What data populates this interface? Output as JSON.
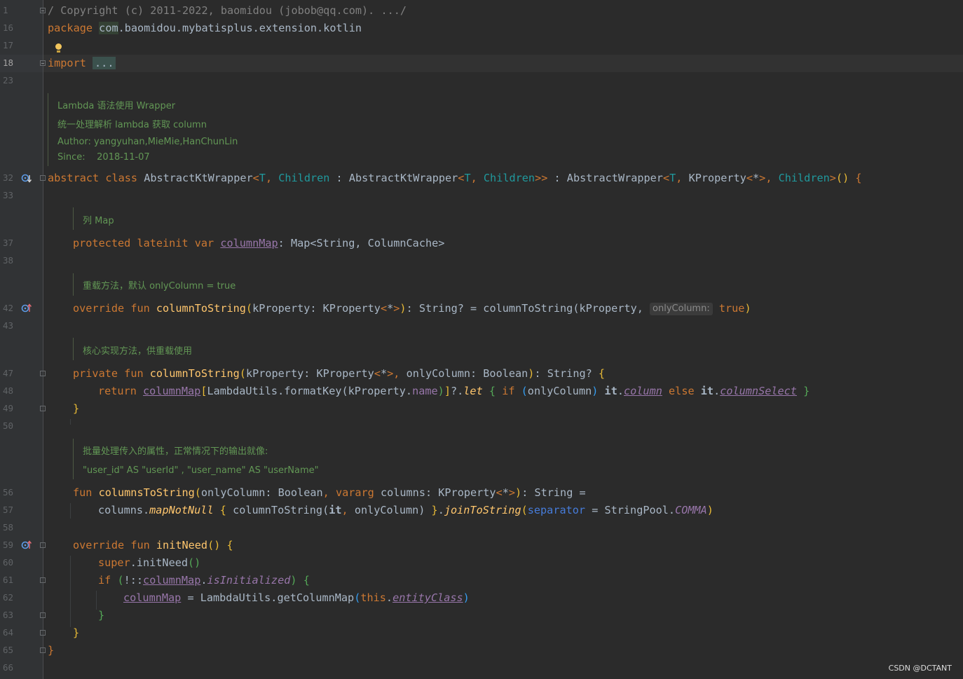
{
  "editor": {
    "current_line": "18",
    "line_numbers": [
      "1",
      "16",
      "17",
      "18",
      "23",
      "32",
      "33",
      "37",
      "38",
      "42",
      "43",
      "47",
      "48",
      "49",
      "50",
      "56",
      "57",
      "58",
      "59",
      "60",
      "61",
      "62",
      "63",
      "64",
      "65",
      "66"
    ],
    "line1_text": "/ Copyright (c) 2011-2022, baomidou (jobob@qq.com). .../",
    "package_keyword": "package",
    "package_first": "com",
    "package_rest": ".baomidou.mybatisplus.extension.kotlin",
    "import_keyword": "import",
    "import_folded": "...",
    "class_doc": [
      "Lambda 语法使用 Wrapper",
      "统一处理解析 lambda 获取 column",
      "Author: yangyuhan,MieMie,HanChunLin",
      "Since:    2018-11-07"
    ],
    "class_decl": {
      "kw_abstract": "abstract",
      "kw_class": "class",
      "name": "AbstractKtWrapper",
      "t": "T",
      "children": "Children",
      "ext1": "AbstractKtWrapper",
      "ext2": "AbstractWrapper",
      "kproperty": "KProperty",
      "star": "*"
    },
    "column_map_doc": "列 Map",
    "column_map_decl": {
      "kw1": "protected",
      "kw2": "lateinit",
      "kw3": "var",
      "name": "columnMap",
      "type": "Map<String, ColumnCache>"
    },
    "override_doc": "重载方法，默认 onlyColumn = true",
    "override_decl": {
      "kw1": "override",
      "kw2": "fun",
      "name": "columnToString",
      "params": "kProperty: KProperty",
      "ret": "String? = columnToString(kProperty, ",
      "hint": "onlyColumn:",
      "true_kw": "true"
    },
    "core_doc": "核心实现方法，供重载使用",
    "private_decl": {
      "kw1": "private",
      "kw2": "fun",
      "name": "columnToString",
      "params": "kProperty: KProperty",
      "params2": "onlyColumn: Boolean",
      "ret": "String?"
    },
    "return_line": {
      "kw_return": "return",
      "map": "columnMap",
      "mid": "LambdaUtils.formatKey(kProperty.",
      "name_prop": "name",
      "let": "let",
      "kw_if": "if",
      "only": "onlyColumn",
      "it": "it",
      "column": "column",
      "kw_else": "else",
      "column_select": "columnSelect"
    },
    "batch_doc": [
      "批量处理传入的属性，正常情况下的输出就像:",
      "\"user_id\" AS \"userId\" , \"user_name\" AS \"userName\""
    ],
    "columns_fn": {
      "kw_fun": "fun",
      "name": "columnsToString",
      "p1": "onlyColumn: Boolean",
      "kw_vararg": "vararg",
      "p2": "columns: KProperty",
      "ret": "String ="
    },
    "columns_body": {
      "recv": "columns.",
      "map_not_null": "mapNotNull",
      "inner": "columnToString(",
      "it": "it",
      "only": "onlyColumn",
      "join": "joinToString",
      "sep": "separator",
      "pool": "StringPool.",
      "comma": "COMMA"
    },
    "init_fn": {
      "kw1": "override",
      "kw2": "fun",
      "name": "initNeed",
      "super_kw": "super",
      "super_call": ".initNeed",
      "kw_if": "if",
      "map": "columnMap",
      "is_init": "isInitialized",
      "assign": " = LambdaUtils.getColumnMap",
      "this_kw": "this",
      "entity": "entityClass"
    },
    "closing_brace": "}",
    "watermark": "CSDN @DCTANT"
  }
}
